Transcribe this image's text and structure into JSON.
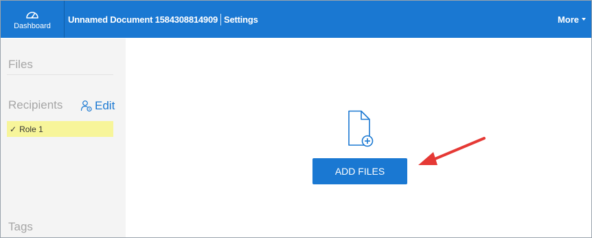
{
  "header": {
    "dashboard_label": "Dashboard",
    "document_title": "Unnamed Document 1584308814909",
    "settings_label": "Settings",
    "more_label": "More"
  },
  "sidebar": {
    "files_heading": "Files",
    "recipients_heading": "Recipients",
    "edit_label": "Edit",
    "roles": [
      {
        "check": "✓",
        "label": "Role 1"
      }
    ],
    "tags_heading": "Tags"
  },
  "main": {
    "add_files_label": "ADD FILES"
  },
  "colors": {
    "brand_blue": "#1a78d2",
    "highlight_yellow": "#f7f59a",
    "annotation_red": "#e53935"
  },
  "icons": {
    "dashboard": "speedometer-icon",
    "edit": "user-settings-icon",
    "file_add": "file-plus-icon",
    "annotation": "arrow-pointer"
  }
}
